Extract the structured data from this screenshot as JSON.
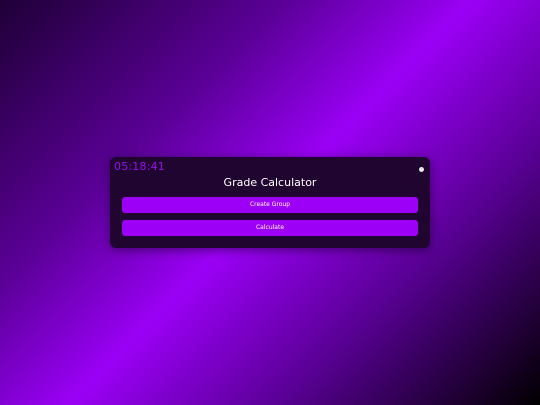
{
  "clock": {
    "time": "05:18:41"
  },
  "panel": {
    "title": "Grade Calculator",
    "buttons": {
      "create_group": "Create Group",
      "calculate": "Calculate"
    }
  },
  "colors": {
    "accent": "#9d00f7",
    "panel_bg": "#1f0530",
    "clock_text": "#9b10f2"
  }
}
